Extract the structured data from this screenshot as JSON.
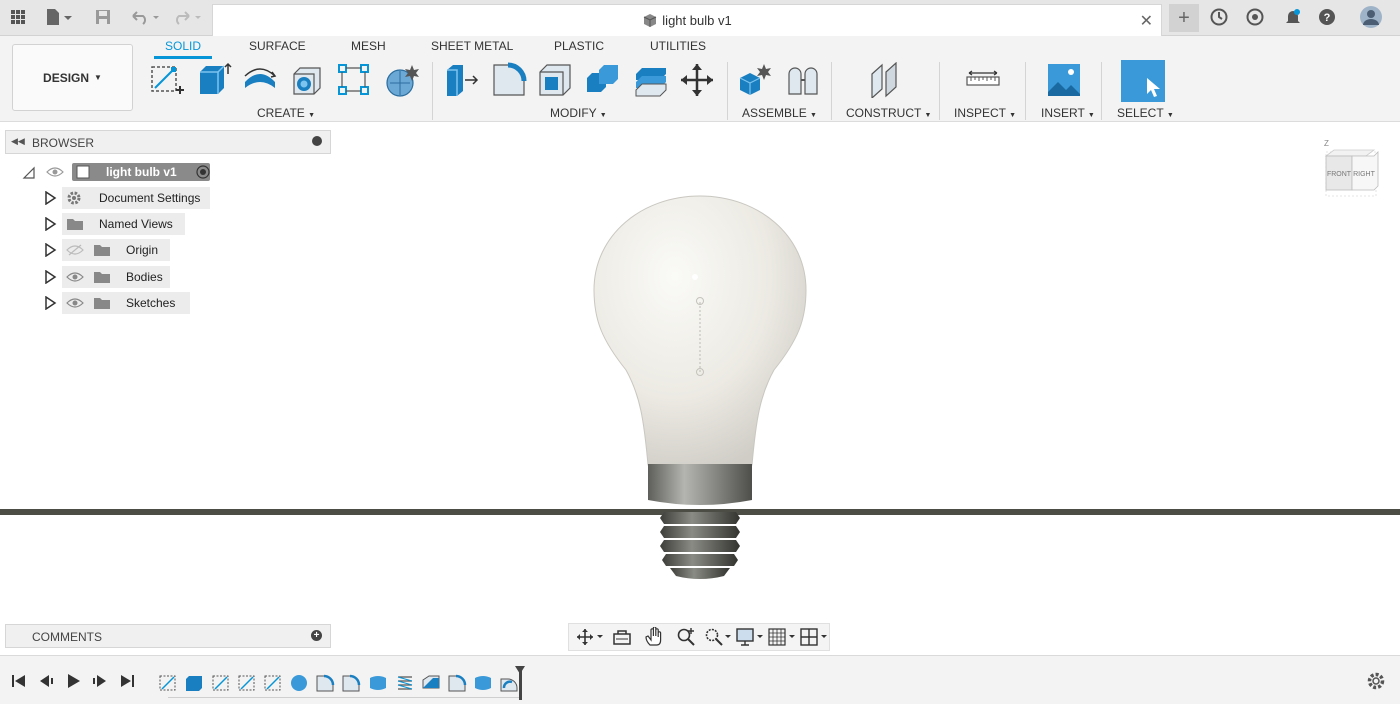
{
  "app": {
    "document_title": "light bulb v1",
    "icons": [
      "grid-icon",
      "file-icon",
      "save-icon",
      "undo-icon",
      "redo-icon",
      "close-icon",
      "plus-icon",
      "extensions-icon",
      "job-status-icon",
      "notifications-icon",
      "help-icon",
      "user-avatar"
    ]
  },
  "toolbar": {
    "workspace_label": "DESIGN",
    "tabs": [
      "SOLID",
      "SURFACE",
      "MESH",
      "SHEET METAL",
      "PLASTIC",
      "UTILITIES"
    ],
    "active_tab": "SOLID",
    "groups": [
      "CREATE",
      "MODIFY",
      "ASSEMBLE",
      "CONSTRUCT",
      "INSPECT",
      "INSERT",
      "SELECT"
    ],
    "accent_color": "#0696d7"
  },
  "browser": {
    "title": "BROWSER",
    "root": "light bulb v1",
    "items": [
      "Document Settings",
      "Named Views",
      "Origin",
      "Bodies",
      "Sketches"
    ]
  },
  "viewcube": {
    "axis": "Z",
    "front": "FRONT",
    "right": "RIGHT"
  },
  "comments": {
    "title": "COMMENTS"
  },
  "navbar": {
    "icons": [
      "orbit-icon",
      "look-at-icon",
      "pan-icon",
      "zoom-icon",
      "fit-icon",
      "display-settings-icon",
      "grid-settings-icon",
      "viewports-icon"
    ]
  },
  "timeline": {
    "feature_count": 14
  }
}
